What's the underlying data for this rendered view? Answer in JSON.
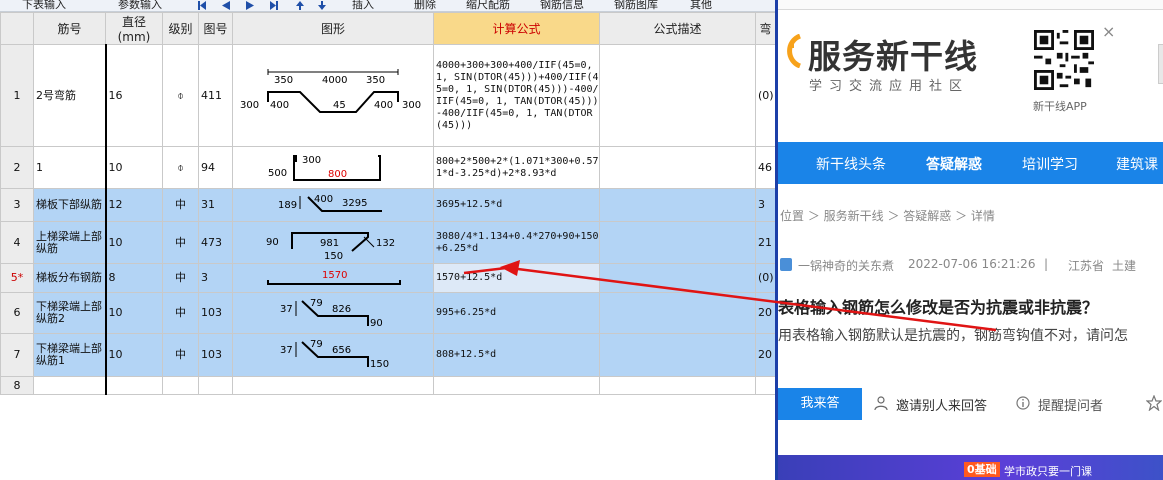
{
  "toolbar": {
    "items": [
      "下表输入",
      "参数输入",
      "插入",
      "删除",
      "缩尺配筋",
      "钢筋信息",
      "钢筋图库",
      "其他"
    ]
  },
  "table": {
    "headers": [
      "",
      "筋号",
      "直径(mm)",
      "级别",
      "图号",
      "图形",
      "计算公式",
      "公式描述",
      "弯"
    ],
    "rows": [
      {
        "num": "1",
        "name": "2号弯筋",
        "dia": "16",
        "grade": "⌽",
        "fig": "411",
        "formula": "4000+300+300+400/IIF(45=0, 1, SIN(DTOR(45)))+400/IIF(45=0, 1, SIN(DTOR(45)))-400/IIF(45=0, 1, TAN(DTOR(45)))-400/IIF(45=0, 1, TAN(DTOR(45)))",
        "desc": "",
        "extra": "(0)",
        "shape": {
          "labels": [
            "350",
            "4000",
            "350",
            "300",
            "400",
            "45",
            "400",
            "300"
          ]
        }
      },
      {
        "num": "2",
        "name": "1",
        "dia": "10",
        "grade": "⌽",
        "fig": "94",
        "formula": "800+2*500+2*(1.071*300+0.571*d-3.25*d)+2*8.93*d",
        "desc": "",
        "extra": "46",
        "shape": {
          "labels": [
            "500",
            "300",
            "800"
          ]
        }
      },
      {
        "num": "3",
        "name": "梯板下部纵筋",
        "dia": "12",
        "grade": "中",
        "fig": "31",
        "formula": "3695+12.5*d",
        "desc": "",
        "extra": "3",
        "shape": {
          "labels": [
            "189",
            "400",
            "3295"
          ]
        }
      },
      {
        "num": "4",
        "name": "上梯梁端上部纵筋",
        "dia": "10",
        "grade": "中",
        "fig": "473",
        "formula": "3080/4*1.134+0.4*270+90+150+6.25*d",
        "desc": "",
        "extra": "21",
        "shape": {
          "labels": [
            "90",
            "981",
            "150",
            "132"
          ]
        }
      },
      {
        "num": "5*",
        "name": "梯板分布钢筋",
        "dia": "8",
        "grade": "中",
        "fig": "3",
        "formula": "1570+12.5*d",
        "desc": "",
        "extra": "(0)",
        "shape": {
          "labels": [
            "1570"
          ]
        }
      },
      {
        "num": "6",
        "name": "下梯梁端上部纵筋2",
        "dia": "10",
        "grade": "中",
        "fig": "103",
        "formula": "995+6.25*d",
        "desc": "",
        "extra": "20",
        "shape": {
          "labels": [
            "37",
            "79",
            "826",
            "90"
          ]
        }
      },
      {
        "num": "7",
        "name": "下梯梁端上部纵筋1",
        "dia": "10",
        "grade": "中",
        "fig": "103",
        "formula": "808+12.5*d",
        "desc": "",
        "extra": "20",
        "shape": {
          "labels": [
            "37",
            "79",
            "656",
            "150"
          ]
        }
      },
      {
        "num": "8",
        "name": "",
        "dia": "",
        "grade": "",
        "fig": "",
        "formula": "",
        "desc": "",
        "extra": "",
        "shape": {
          "labels": []
        }
      }
    ]
  },
  "web": {
    "brand_name": "服务新干线",
    "brand_slogan": "学习交流应用社区",
    "qr_caption": "新干线APP",
    "qr_close": "×",
    "nav": [
      "新干线头条",
      "答疑解惑",
      "培训学习",
      "建筑课"
    ],
    "breadcrumb": "位置 ＞ 服务新干线 ＞ 答疑解惑 ＞ 详情",
    "author": "一锅神奇的关东煮",
    "date": "2022-07-06 16:21:26",
    "sep": "|",
    "location": "江苏省",
    "category": "土建",
    "question_title": "表格输入钢筋怎么修改是否为抗震或非抗震？",
    "question_body": "用表格输入钢筋默认是抗震的，钢筋弯钩值不对，请问怎",
    "answer_button": "我来答",
    "invite": "邀请别人来回答",
    "remind": "提醒提问者",
    "banner_badge": "0基础",
    "banner_text": "学市政只要一门课"
  },
  "colors": {
    "nav_blue": "#1a84e8",
    "selected_row": "#b3d4f5",
    "active_header": "#f9d98a",
    "arrow_red": "#e01414"
  }
}
